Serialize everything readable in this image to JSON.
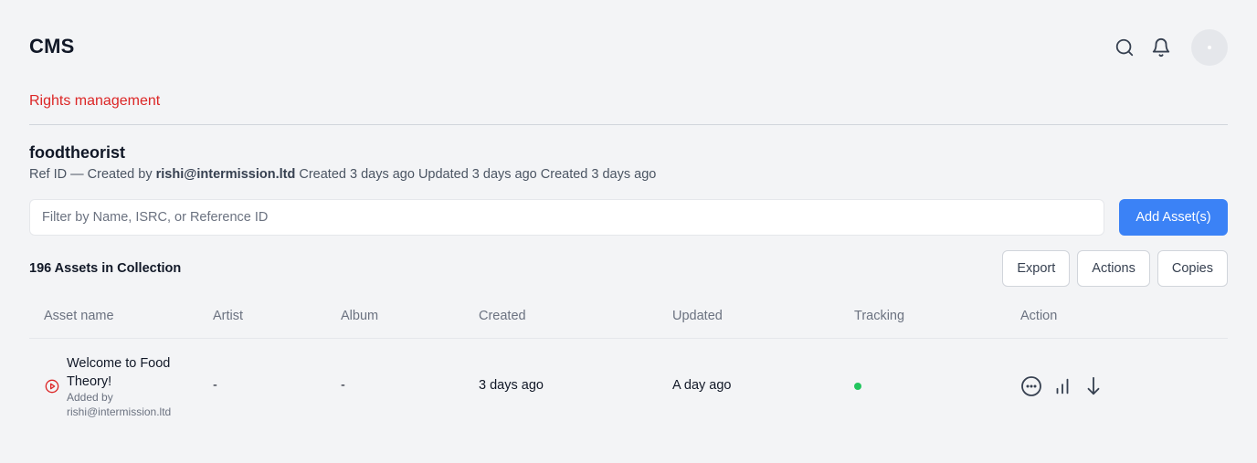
{
  "app": {
    "title": "CMS"
  },
  "header": {
    "search_icon": "search-icon",
    "bell_icon": "bell-icon"
  },
  "breadcrumb": {
    "label": "Rights management",
    "color": "#dc2626"
  },
  "collection": {
    "name": "foodtheorist",
    "meta_prefix": "Ref ID — Created by",
    "creator": "rishi@intermission.ltd",
    "meta_suffix": "Created 3 days ago Updated 3 days ago Created 3 days ago"
  },
  "filter": {
    "placeholder": "Filter by Name, ISRC, or Reference ID",
    "value": ""
  },
  "add_button": {
    "label": "Add Asset(s)",
    "color": "#3b82f6"
  },
  "count_label": "196 Assets in Collection",
  "toolbar": {
    "export": "Export",
    "actions": "Actions",
    "copies": "Copies"
  },
  "table": {
    "columns": [
      "Asset name",
      "Artist",
      "Album",
      "Created",
      "Updated",
      "Tracking",
      "Action"
    ],
    "rows": [
      {
        "asset_name": "Welcome to Food Theory!",
        "added_by": "Added by rishi@intermission.ltd",
        "artist": "-",
        "album": "-",
        "created": "3 days ago",
        "updated": "A day ago",
        "tracking_color": "#22c55e",
        "actions": [
          "more-icon",
          "stats-icon",
          "download-icon"
        ]
      }
    ]
  }
}
